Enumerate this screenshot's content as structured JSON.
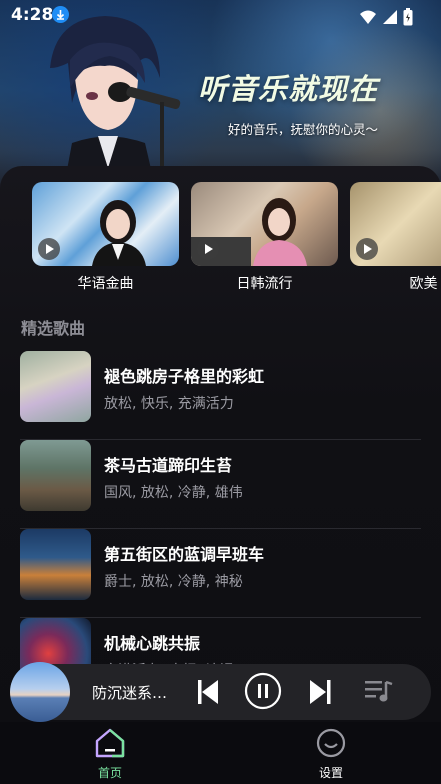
{
  "status_bar": {
    "time": "4:28"
  },
  "hero": {
    "slogan": "听音乐就现在",
    "tagline": "好的音乐，抚慰你的心灵～"
  },
  "categories": [
    {
      "label": "华语金曲"
    },
    {
      "label": "日韩流行"
    },
    {
      "label": "欧美"
    }
  ],
  "section": {
    "title": "精选歌曲"
  },
  "songs": [
    {
      "title": "褪色跳房子格里的彩虹",
      "tags": "放松, 快乐, 充满活力"
    },
    {
      "title": "茶马古道蹄印生苔",
      "tags": "国风, 放松, 冷静, 雄伟"
    },
    {
      "title": "第五街区的蓝调早班车",
      "tags": "爵士, 放松, 冷静, 神秘"
    },
    {
      "title": "机械心跳共振",
      "tags": "充满活力, 古怪, 浪漫"
    }
  ],
  "player": {
    "title": "防沉迷系…"
  },
  "tabs": [
    {
      "label": "首页",
      "icon": "home-icon",
      "active": true
    },
    {
      "label": "设置",
      "icon": "settings-icon",
      "active": false
    }
  ],
  "colors": {
    "accent": "#7be3a0",
    "panel": "#101014",
    "player": "#232327"
  }
}
